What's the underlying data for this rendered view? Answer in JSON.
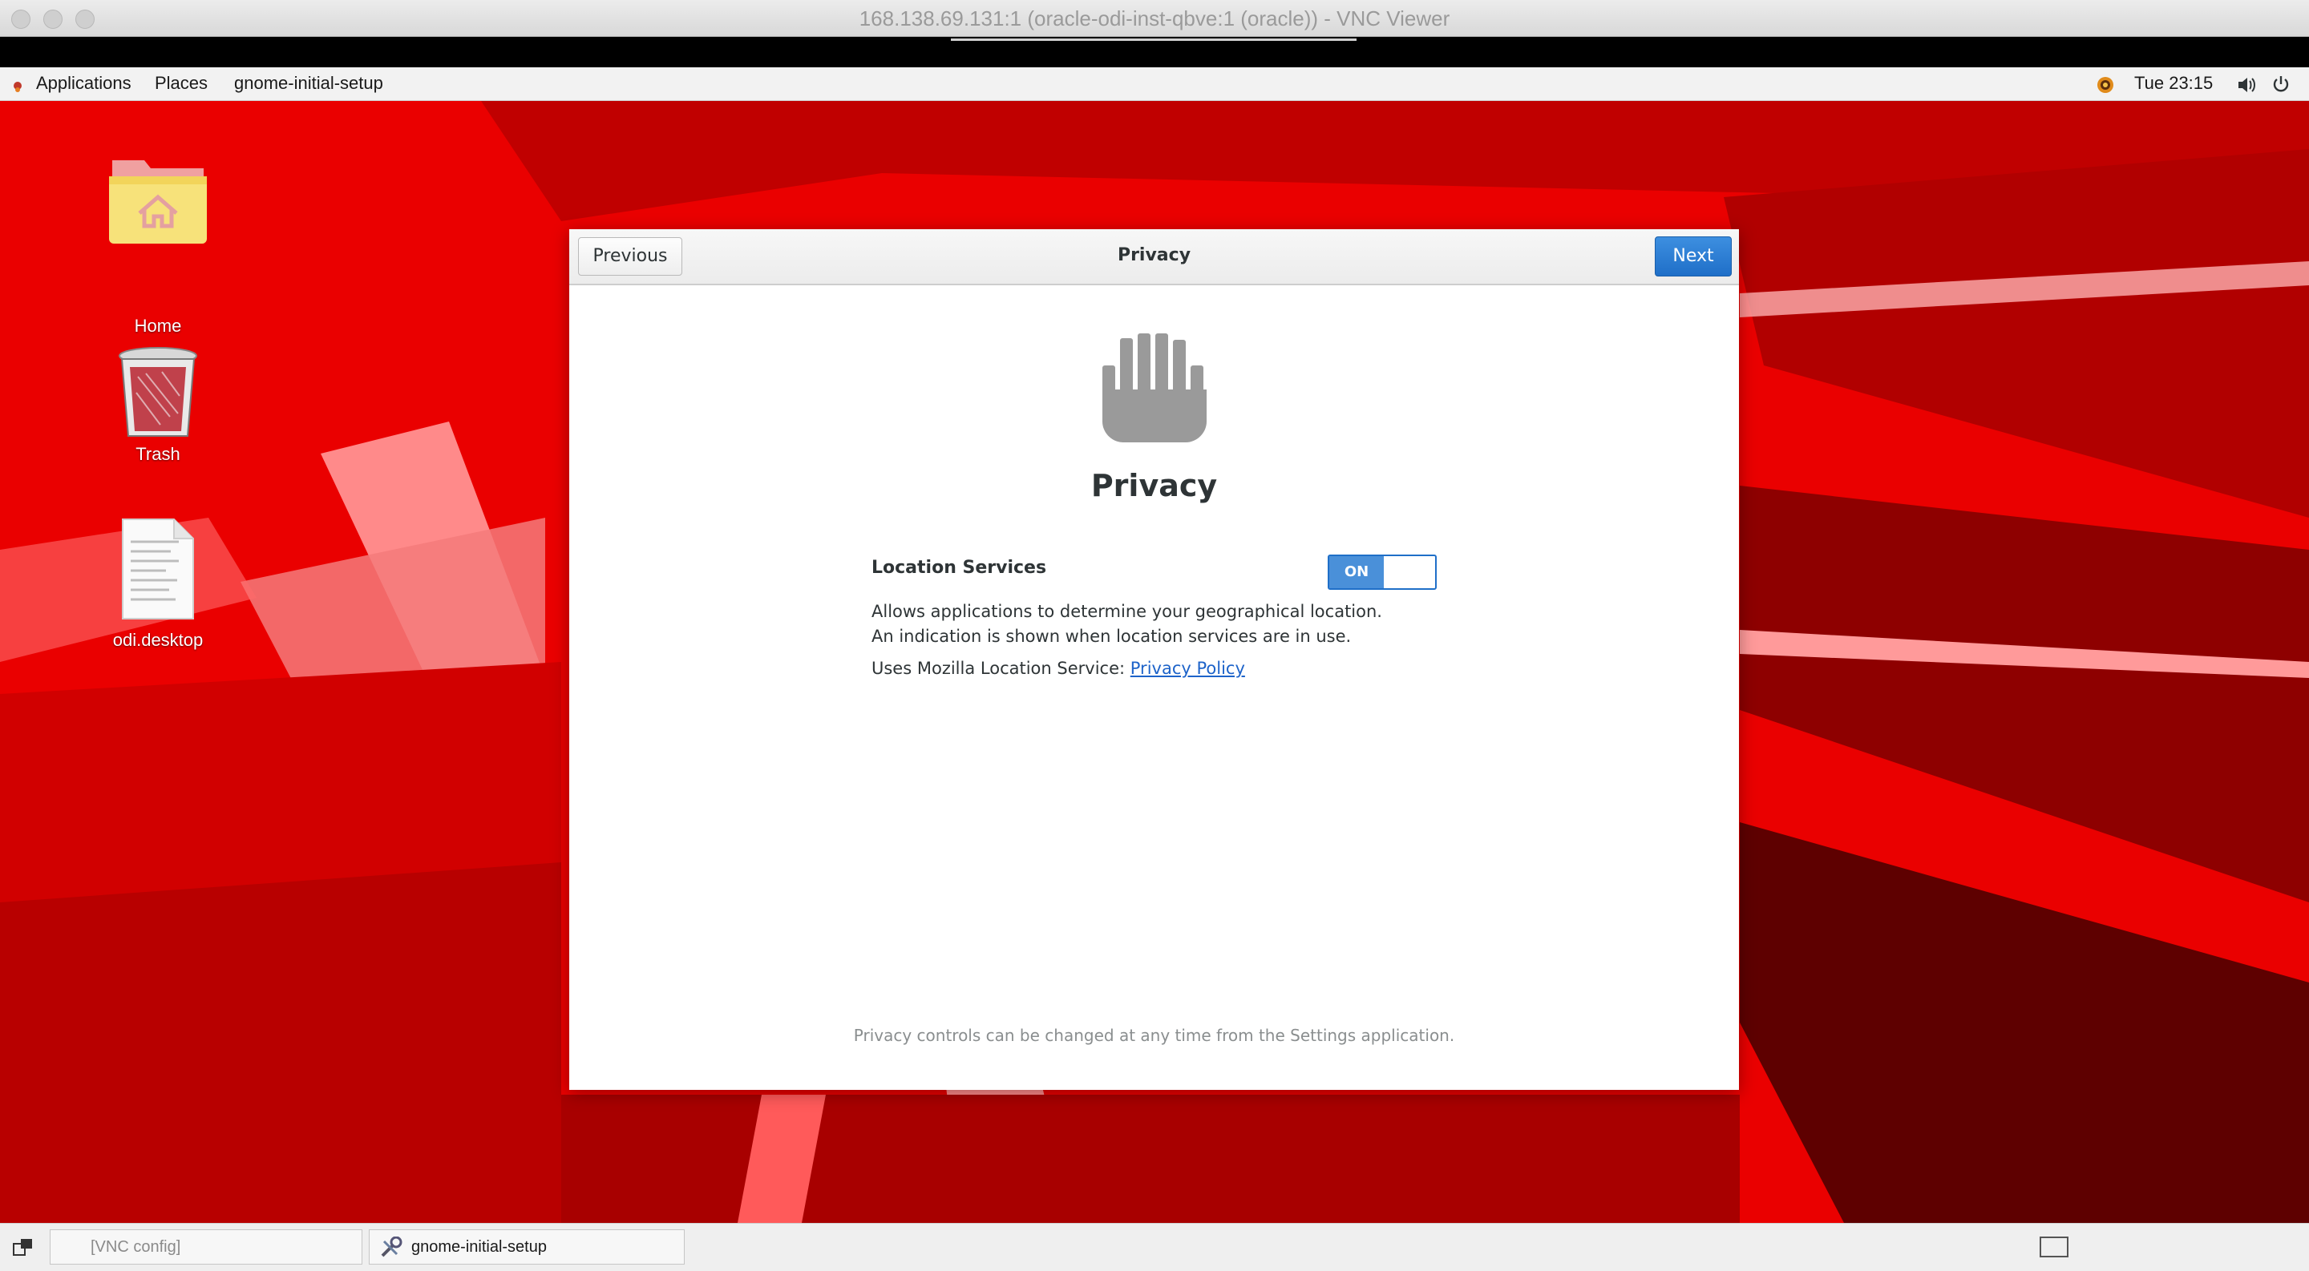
{
  "vnc_window": {
    "title": "168.138.69.131:1 (oracle-odi-inst-qbve:1 (oracle)) - VNC Viewer"
  },
  "top_panel": {
    "applications": "Applications",
    "places": "Places",
    "app_name": "gnome-initial-setup",
    "clock": "Tue 23:15"
  },
  "desktop": {
    "icons": [
      {
        "label": "Home",
        "icon": "home-folder-icon"
      },
      {
        "label": "Trash",
        "icon": "trash-icon"
      },
      {
        "label": "odi.desktop",
        "icon": "desktop-file-icon"
      }
    ]
  },
  "dialog": {
    "previous_label": "Previous",
    "title": "Privacy",
    "next_label": "Next",
    "heading": "Privacy",
    "location_label": "Location Services",
    "toggle_state": "ON",
    "description": "Allows applications to determine your geographical location. An indication is shown when location services are in use.",
    "mozilla_text": "Uses Mozilla Location Service:",
    "privacy_policy_link": "Privacy Policy",
    "footer": "Privacy controls can be changed at any time from the Settings application."
  },
  "taskbar": {
    "vnc_config": "[VNC config]",
    "active_window": "gnome-initial-setup"
  },
  "colors": {
    "desktop_red": "#ea0000",
    "accent_blue": "#1f6fc8",
    "toggle_on": "#4a90d9"
  }
}
